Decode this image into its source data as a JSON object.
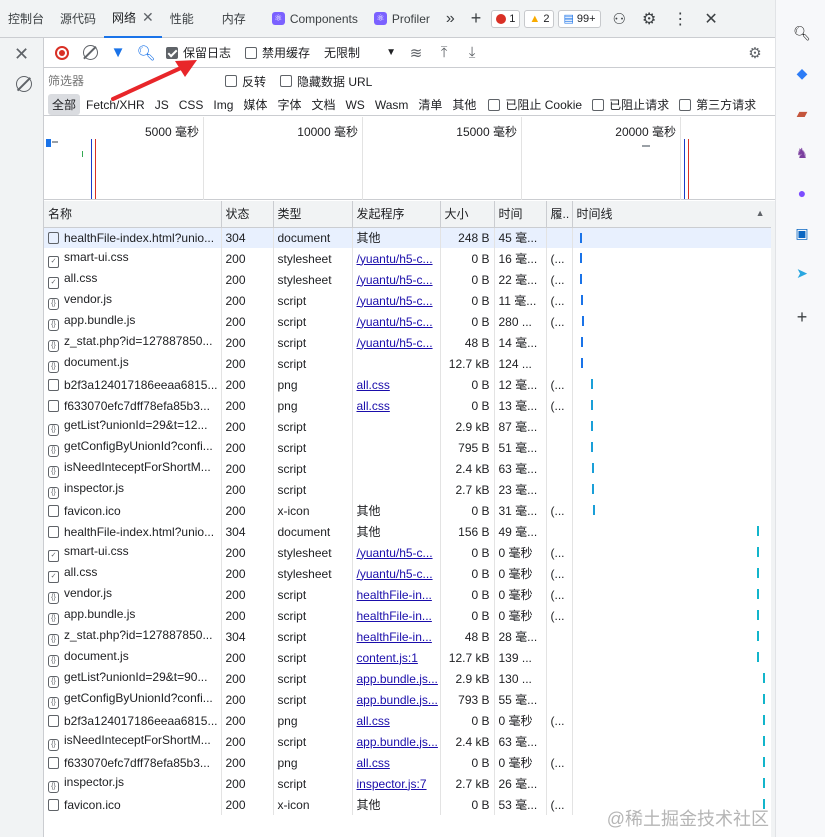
{
  "tabs": [
    {
      "label": "控制台"
    },
    {
      "label": "源代码"
    },
    {
      "label": "网络",
      "active": true
    },
    {
      "label": "性能"
    },
    {
      "label": "内存"
    },
    {
      "label": "Components"
    },
    {
      "label": "Profiler"
    }
  ],
  "badges": {
    "errors": "1",
    "warnings": "2",
    "info": "99+"
  },
  "toolbar": {
    "preserve_log_label": "保留日志",
    "preserve_log_checked": true,
    "disable_cache_label": "禁用缓存",
    "throttle_value": "无限制"
  },
  "filter": {
    "placeholder": "筛选器",
    "invert_label": "反转",
    "hide_data_urls_label": "隐藏数据 URL"
  },
  "types": [
    "全部",
    "Fetch/XHR",
    "JS",
    "CSS",
    "Img",
    "媒体",
    "字体",
    "文档",
    "WS",
    "Wasm",
    "清单",
    "其他"
  ],
  "type_checks": [
    "已阻止 Cookie",
    "已阻止请求",
    "第三方请求"
  ],
  "overview": {
    "ticks": [
      "5000 毫秒",
      "10000 毫秒",
      "15000 毫秒",
      "20000 毫秒"
    ]
  },
  "columns": [
    "名称",
    "状态",
    "类型",
    "发起程序",
    "大小",
    "时间",
    "履..",
    "时间线"
  ],
  "rows": [
    {
      "name": "healthFile-index.html?unio...",
      "status": "304",
      "type": "document",
      "initiator": "其他",
      "link": false,
      "size": "248 B",
      "time": "45 毫...",
      "f": "",
      "icon": "doc",
      "wf": 0.02
    },
    {
      "name": "smart-ui.css",
      "status": "200",
      "type": "stylesheet",
      "initiator": "/yuantu/h5-c...",
      "link": true,
      "size": "0 B",
      "time": "16 毫...",
      "f": "(...",
      "icon": "css",
      "wf": 0.02
    },
    {
      "name": "all.css",
      "status": "200",
      "type": "stylesheet",
      "initiator": "/yuantu/h5-c...",
      "link": true,
      "size": "0 B",
      "time": "22 毫...",
      "f": "(...",
      "icon": "css",
      "wf": 0.02
    },
    {
      "name": "vendor.js",
      "status": "200",
      "type": "script",
      "initiator": "/yuantu/h5-c...",
      "link": true,
      "size": "0 B",
      "time": "11 毫...",
      "f": "(...",
      "icon": "js",
      "wf": 0.025
    },
    {
      "name": "app.bundle.js",
      "status": "200",
      "type": "script",
      "initiator": "/yuantu/h5-c...",
      "link": true,
      "size": "0 B",
      "time": "280 ...",
      "f": "(...",
      "icon": "js",
      "wf": 0.03
    },
    {
      "name": "z_stat.php?id=127887850...",
      "status": "200",
      "type": "script",
      "initiator": "/yuantu/h5-c...",
      "link": true,
      "size": "48 B",
      "time": "14 毫...",
      "f": "",
      "icon": "js",
      "wf": 0.025
    },
    {
      "name": "document.js",
      "status": "200",
      "type": "script",
      "initiator": "",
      "link": false,
      "size": "12.7 kB",
      "time": "124 ...",
      "f": "",
      "icon": "js",
      "wf": 0.025
    },
    {
      "name": "b2f3a124017186eeaa6815...",
      "status": "200",
      "type": "png",
      "initiator": "all.css",
      "link": true,
      "size": "0 B",
      "time": "12 毫...",
      "f": "(...",
      "icon": "file",
      "wf": 0.08
    },
    {
      "name": "f633070efc7dff78efa85b3...",
      "status": "200",
      "type": "png",
      "initiator": "all.css",
      "link": true,
      "size": "0 B",
      "time": "13 毫...",
      "f": "(...",
      "icon": "file",
      "wf": 0.08
    },
    {
      "name": "getList?unionId=29&t=12...",
      "status": "200",
      "type": "script",
      "initiator": "",
      "link": false,
      "size": "2.9 kB",
      "time": "87 毫...",
      "f": "",
      "icon": "js",
      "wf": 0.08
    },
    {
      "name": "getConfigByUnionId?confi...",
      "status": "200",
      "type": "script",
      "initiator": "",
      "link": false,
      "size": "795 B",
      "time": "51 毫...",
      "f": "",
      "icon": "js",
      "wf": 0.08
    },
    {
      "name": "isNeedInteceptForShortM...",
      "status": "200",
      "type": "script",
      "initiator": "",
      "link": false,
      "size": "2.4 kB",
      "time": "63 毫...",
      "f": "",
      "icon": "js",
      "wf": 0.085
    },
    {
      "name": "inspector.js",
      "status": "200",
      "type": "script",
      "initiator": "",
      "link": false,
      "size": "2.7 kB",
      "time": "23 毫...",
      "f": "",
      "icon": "js",
      "wf": 0.085
    },
    {
      "name": "favicon.ico",
      "status": "200",
      "type": "x-icon",
      "initiator": "其他",
      "link": false,
      "size": "0 B",
      "time": "31 毫...",
      "f": "(...",
      "icon": "img",
      "wf": 0.09
    },
    {
      "name": "healthFile-index.html?unio...",
      "status": "304",
      "type": "document",
      "initiator": "其他",
      "link": false,
      "size": "156 B",
      "time": "49 毫...",
      "f": "",
      "icon": "doc",
      "wf": 0.97
    },
    {
      "name": "smart-ui.css",
      "status": "200",
      "type": "stylesheet",
      "initiator": "/yuantu/h5-c...",
      "link": true,
      "size": "0 B",
      "time": "0 毫秒",
      "f": "(...",
      "icon": "css",
      "wf": 0.97
    },
    {
      "name": "all.css",
      "status": "200",
      "type": "stylesheet",
      "initiator": "/yuantu/h5-c...",
      "link": true,
      "size": "0 B",
      "time": "0 毫秒",
      "f": "(...",
      "icon": "css",
      "wf": 0.97
    },
    {
      "name": "vendor.js",
      "status": "200",
      "type": "script",
      "initiator": "healthFile-in...",
      "link": true,
      "size": "0 B",
      "time": "0 毫秒",
      "f": "(...",
      "icon": "js",
      "wf": 0.97
    },
    {
      "name": "app.bundle.js",
      "status": "200",
      "type": "script",
      "initiator": "healthFile-in...",
      "link": true,
      "size": "0 B",
      "time": "0 毫秒",
      "f": "(...",
      "icon": "js",
      "wf": 0.97
    },
    {
      "name": "z_stat.php?id=127887850...",
      "status": "304",
      "type": "script",
      "initiator": "healthFile-in...",
      "link": true,
      "size": "48 B",
      "time": "28 毫...",
      "f": "",
      "icon": "js",
      "wf": 0.97
    },
    {
      "name": "document.js",
      "status": "200",
      "type": "script",
      "initiator": "content.js:1",
      "link": true,
      "size": "12.7 kB",
      "time": "139 ...",
      "f": "",
      "icon": "js",
      "wf": 0.97
    },
    {
      "name": "getList?unionId=29&t=90...",
      "status": "200",
      "type": "script",
      "initiator": "app.bundle.js...",
      "link": true,
      "size": "2.9 kB",
      "time": "130 ...",
      "f": "",
      "icon": "js",
      "wf": 1.0
    },
    {
      "name": "getConfigByUnionId?confi...",
      "status": "200",
      "type": "script",
      "initiator": "app.bundle.js...",
      "link": true,
      "size": "793 B",
      "time": "55 毫...",
      "f": "",
      "icon": "js",
      "wf": 1.0
    },
    {
      "name": "b2f3a124017186eeaa6815...",
      "status": "200",
      "type": "png",
      "initiator": "all.css",
      "link": true,
      "size": "0 B",
      "time": "0 毫秒",
      "f": "(...",
      "icon": "file",
      "wf": 1.0
    },
    {
      "name": "isNeedInteceptForShortM...",
      "status": "200",
      "type": "script",
      "initiator": "app.bundle.js...",
      "link": true,
      "size": "2.4 kB",
      "time": "63 毫...",
      "f": "",
      "icon": "js",
      "wf": 1.0
    },
    {
      "name": "f633070efc7dff78efa85b3...",
      "status": "200",
      "type": "png",
      "initiator": "all.css",
      "link": true,
      "size": "0 B",
      "time": "0 毫秒",
      "f": "(...",
      "icon": "file",
      "wf": 1.0
    },
    {
      "name": "inspector.js",
      "status": "200",
      "type": "script",
      "initiator": "inspector.js:7",
      "link": true,
      "size": "2.7 kB",
      "time": "26 毫...",
      "f": "",
      "icon": "js",
      "wf": 1.0
    },
    {
      "name": "favicon.ico",
      "status": "200",
      "type": "x-icon",
      "initiator": "其他",
      "link": false,
      "size": "0 B",
      "time": "53 毫...",
      "f": "(...",
      "icon": "img",
      "wf": 1.0
    }
  ],
  "watermark": "@稀土掘金技术社区",
  "colors": {
    "accent": "#1a73e8",
    "arrow": "#e8262a",
    "record": "#d93025"
  }
}
